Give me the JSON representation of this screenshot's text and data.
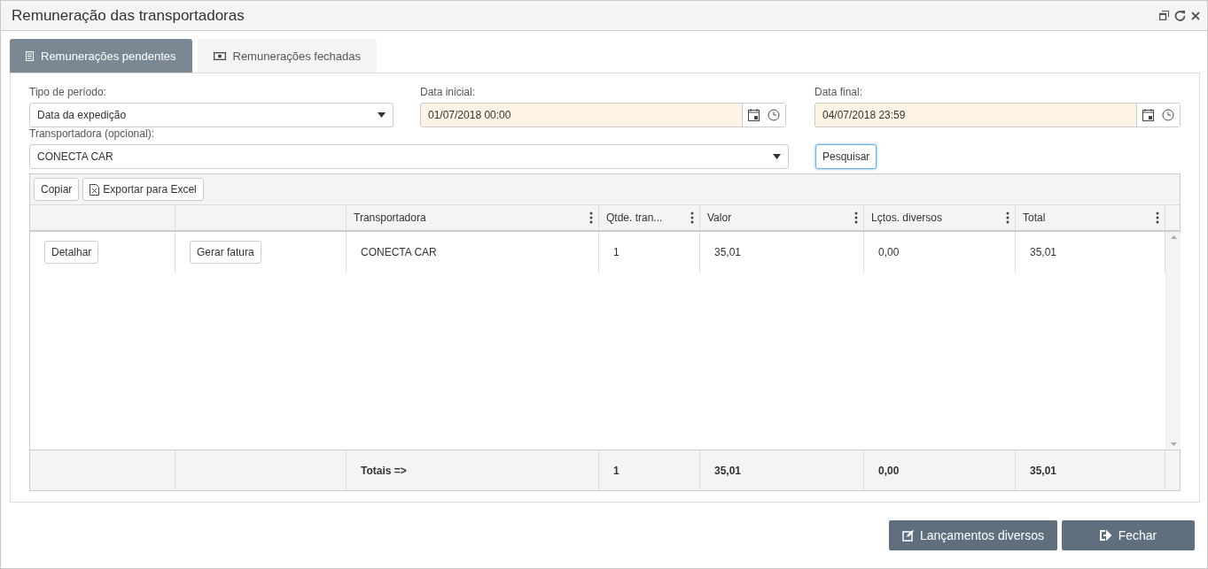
{
  "window": {
    "title": "Remuneração das transportadoras"
  },
  "tabs": [
    {
      "label": "Remunerações pendentes",
      "selected": true,
      "kind": "list"
    },
    {
      "label": "Remunerações fechadas",
      "selected": false,
      "kind": "money"
    }
  ],
  "filters": {
    "period": {
      "label": "Tipo de período:",
      "value": "Data da expedição"
    },
    "start": {
      "label": "Data inicial:",
      "value": "01/07/2018 00:00"
    },
    "end": {
      "label": "Data final:",
      "value": "04/07/2018 23:59"
    },
    "carrier": {
      "label": "Transportadora (opcional):",
      "value": "CONECTA CAR"
    },
    "search_button": "Pesquisar"
  },
  "toolbar": [
    {
      "label": "Copiar",
      "kind": "plain"
    },
    {
      "label": "Exportar para Excel",
      "kind": "excel"
    }
  ],
  "table": {
    "columns": [
      "Transportadora",
      "Qtde. tran...",
      "Valor",
      "Lçtos. diversos",
      "Total"
    ],
    "rows": [
      {
        "actions": [
          "Detalhar",
          "Gerar fatura"
        ],
        "cells": [
          "CONECTA CAR",
          "1",
          "35,01",
          "0,00",
          "35,01"
        ]
      }
    ],
    "totals": [
      "Totais =>",
      "1",
      "35,01",
      "0,00",
      "35,01"
    ]
  },
  "footer_buttons": [
    {
      "label": "Lançamentos diversos",
      "kind": "edit"
    },
    {
      "label": "Fechar",
      "kind": "exit"
    }
  ]
}
